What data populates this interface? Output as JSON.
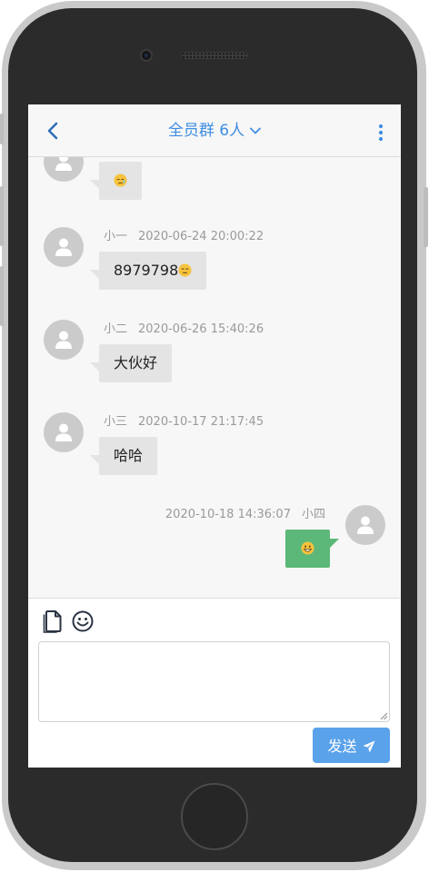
{
  "header": {
    "title": "全员群 6人"
  },
  "messages": [
    {
      "sender": "",
      "time": "",
      "text": "",
      "emoji": "sleepy-face",
      "side": "left"
    },
    {
      "sender": "小一",
      "time": "2020-06-24 20:00:22",
      "text": "8979798",
      "emoji": "neutral-face",
      "side": "left"
    },
    {
      "sender": "小二",
      "time": "2020-06-26 15:40:26",
      "text": "大伙好",
      "emoji": "",
      "side": "left"
    },
    {
      "sender": "小三",
      "time": "2020-10-17 21:17:45",
      "text": "哈哈",
      "emoji": "",
      "side": "left"
    },
    {
      "sender": "小四",
      "time": "2020-10-18 14:36:07",
      "text": "",
      "emoji": "grinning-face",
      "side": "right"
    }
  ],
  "composer": {
    "input_value": "",
    "send_label": "发送"
  },
  "colors": {
    "accent": "#3f8de1",
    "send_button": "#5aa2ea",
    "outgoing_bubble": "#5cb878",
    "incoming_bubble": "#e4e4e4"
  }
}
